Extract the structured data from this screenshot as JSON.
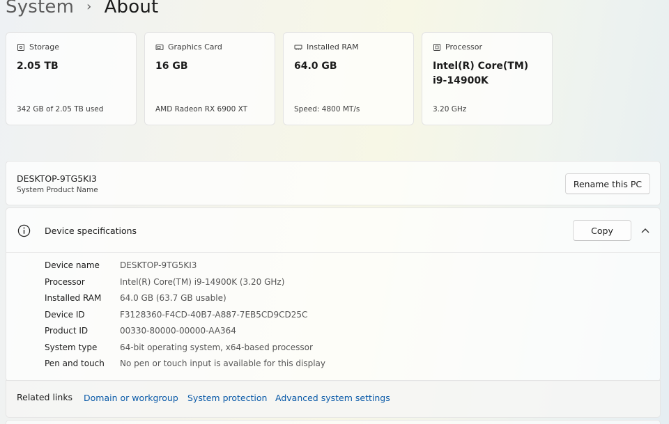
{
  "breadcrumb": {
    "parent": "System",
    "current": "About"
  },
  "cards": [
    {
      "label": "Storage",
      "value": "2.05 TB",
      "sub": "342 GB of 2.05 TB used",
      "icon": "storage-icon"
    },
    {
      "label": "Graphics Card",
      "value": "16 GB",
      "sub": "AMD Radeon RX 6900 XT",
      "icon": "graphics-card-icon"
    },
    {
      "label": "Installed RAM",
      "value": "64.0 GB",
      "sub": "Speed: 4800 MT/s",
      "icon": "ram-icon"
    },
    {
      "label": "Processor",
      "value_line1": "Intel(R) Core(TM)",
      "value_line2": "i9-14900K",
      "sub": "3.20 GHz",
      "icon": "processor-icon"
    }
  ],
  "pc": {
    "name": "DESKTOP-9TG5KI3",
    "subtitle": "System Product Name",
    "rename_label": "Rename this PC"
  },
  "specs": {
    "title": "Device specifications",
    "copy_label": "Copy",
    "rows": [
      {
        "key": "Device name",
        "value": "DESKTOP-9TG5KI3"
      },
      {
        "key": "Processor",
        "value": "Intel(R) Core(TM) i9-14900K (3.20 GHz)"
      },
      {
        "key": "Installed RAM",
        "value": "64.0 GB (63.7 GB usable)"
      },
      {
        "key": "Device ID",
        "value": "F3128360-F4CD-40B7-A887-7EB5CD9CD25C"
      },
      {
        "key": "Product ID",
        "value": "00330-80000-00000-AA364"
      },
      {
        "key": "System type",
        "value": "64-bit operating system, x64-based processor"
      },
      {
        "key": "Pen and touch",
        "value": "No pen or touch input is available for this display"
      }
    ]
  },
  "related": {
    "label": "Related links",
    "links": [
      "Domain or workgroup",
      "System protection",
      "Advanced system settings"
    ]
  }
}
